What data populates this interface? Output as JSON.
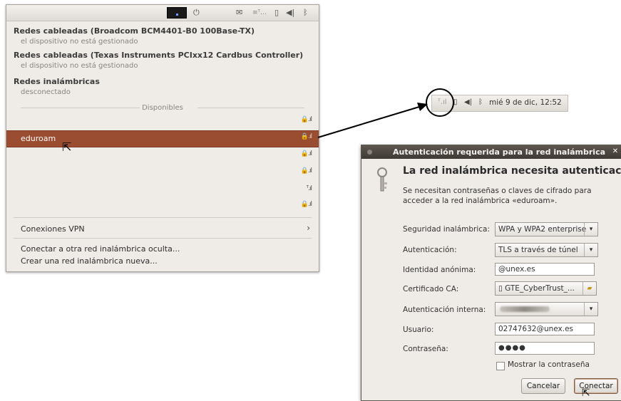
{
  "menu": {
    "wired1": {
      "title": "Redes cableadas (Broadcom BCM4401-B0 100Base-TX)",
      "status": "el dispositivo no está gestionado"
    },
    "wired2": {
      "title": "Redes cableadas (Texas Instruments PCIxx12 Cardbus Controller)",
      "status": "el dispositivo no está gestionado"
    },
    "wireless": {
      "title": "Redes inalámbricas",
      "status": "desconectado"
    },
    "available_label": "Disponibles",
    "networks": [
      {
        "name": "",
        "secured": true
      },
      {
        "name": "eduroam",
        "secured": true,
        "selected": true
      },
      {
        "name": "",
        "secured": true
      },
      {
        "name": "",
        "secured": true
      },
      {
        "name": "",
        "secured": false
      },
      {
        "name": "",
        "secured": true
      }
    ],
    "vpn_label": "Conexiones VPN",
    "connect_hidden": "Conectar a otra red inalámbrica oculta...",
    "create_new": "Crear una red inalámbrica nueva..."
  },
  "panel": {
    "clock": "mié  9 de dic, 12:52"
  },
  "dialog": {
    "window_title": "Autenticación requerida para la red inalámbrica",
    "heading": "La red inalámbrica necesita autenticación",
    "description": "Se necesitan contraseñas o claves de cifrado para acceder a la red inalámbrica «eduroam».",
    "labels": {
      "security": "Seguridad inalámbrica:",
      "auth": "Autenticación:",
      "anon_identity": "Identidad anónima:",
      "ca_cert": "Certificado CA:",
      "inner_auth": "Autenticación interna:",
      "user": "Usuario:",
      "password": "Contraseña:"
    },
    "values": {
      "security": "WPA y WPA2 enterprise",
      "auth": "TLS a través de túnel",
      "anon_identity": "@unex.es",
      "ca_cert": "GTE_CyberTrust_...",
      "user": "02747632@unex.es",
      "password": "●●●●"
    },
    "show_password": "Mostrar la contraseña",
    "cancel": "Cancelar",
    "connect": "Conectar"
  },
  "colors": {
    "selection": "#9a4d30",
    "menu_bg": "#efebe7",
    "dialog_title_bg": "#4a443e"
  }
}
